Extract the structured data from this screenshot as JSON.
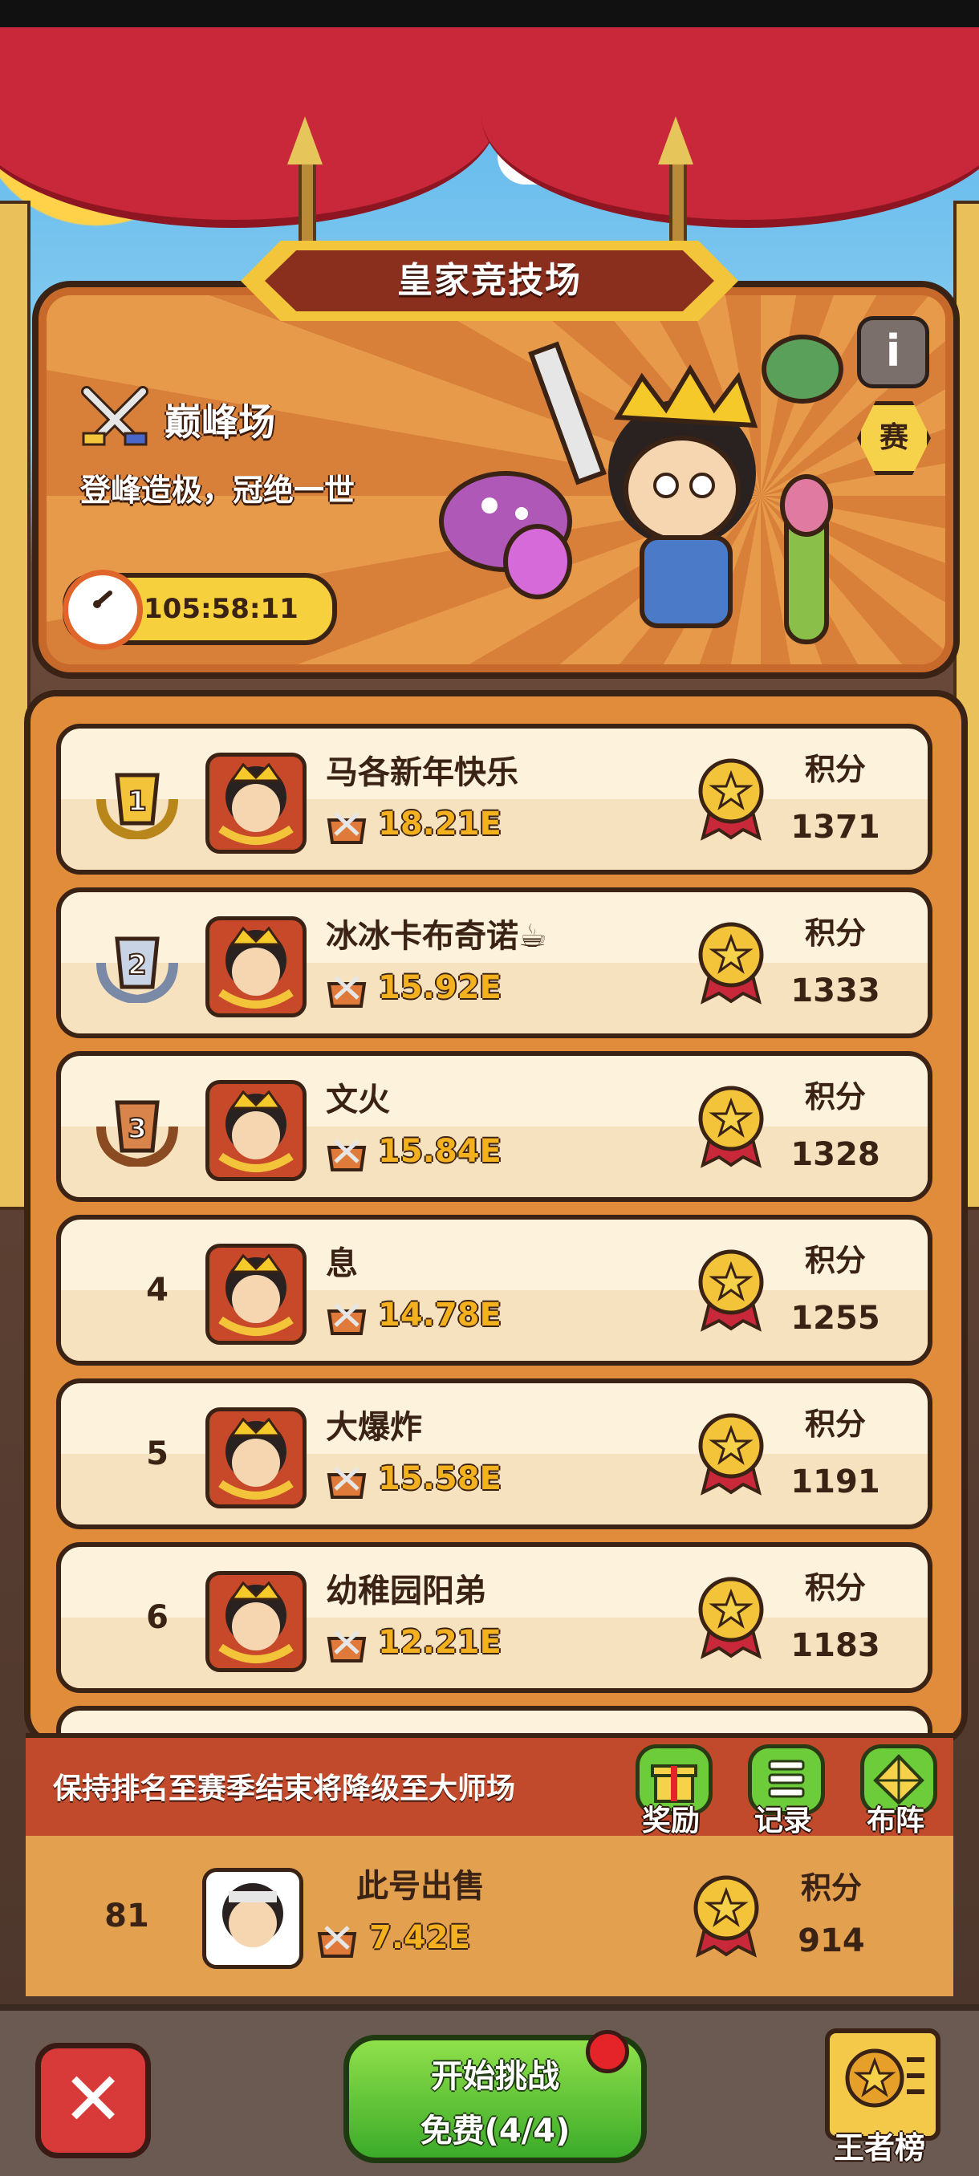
{
  "header": {
    "title": "皇家竞技场",
    "league_name": "巅峰场",
    "motto": "登峰造极，冠绝一世",
    "timer": "105:58:11",
    "info_icon": "i",
    "season_badge": "赛"
  },
  "ranking": {
    "score_label": "积分",
    "rows": [
      {
        "rank": "1",
        "name": "马各新年快乐",
        "power": "18.21E",
        "score": "1371",
        "medal": "gold"
      },
      {
        "rank": "2",
        "name": "冰冰卡布奇诺☕",
        "power": "15.92E",
        "score": "1333",
        "medal": "silver"
      },
      {
        "rank": "3",
        "name": "文火",
        "power": "15.84E",
        "score": "1328",
        "medal": "bronze"
      },
      {
        "rank": "4",
        "name": "息",
        "power": "14.78E",
        "score": "1255",
        "medal": ""
      },
      {
        "rank": "5",
        "name": "大爆炸",
        "power": "15.58E",
        "score": "1191",
        "medal": ""
      },
      {
        "rank": "6",
        "name": "幼稚园阳弟",
        "power": "12.21E",
        "score": "1183",
        "medal": ""
      }
    ]
  },
  "notice": {
    "text": "保持排名至赛季结束将降级至大师场",
    "reward_label": "奖励",
    "record_label": "记录",
    "formation_label": "布阵"
  },
  "self": {
    "rank": "81",
    "name": "此号出售",
    "power": "7.42E",
    "score": "914"
  },
  "bottom": {
    "close_icon": "✕",
    "start_label": "开始挑战",
    "free_label": "免费(4/4)",
    "king_label": "王者榜"
  },
  "colors": {
    "gold": "#f3c33a",
    "silver": "#b9c8dc",
    "bronze": "#c86a3a",
    "panel": "#e08c3a",
    "accent_green": "#6ccc3a"
  }
}
